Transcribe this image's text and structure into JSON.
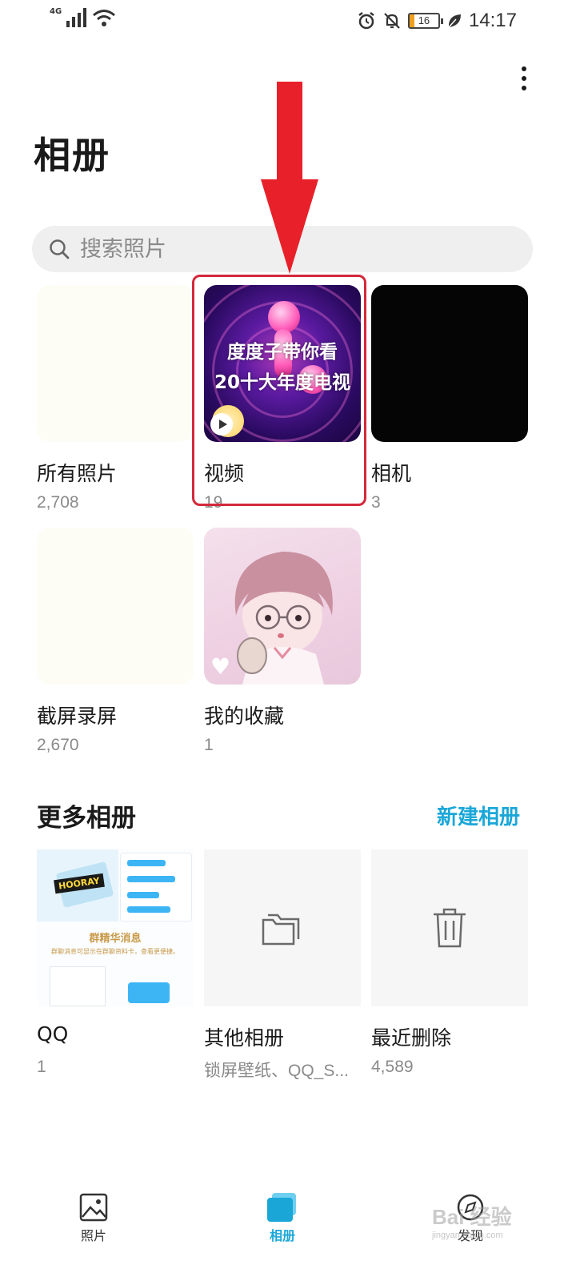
{
  "status_bar": {
    "network": "4G",
    "battery": "16",
    "time": "14:17"
  },
  "header": {
    "title": "相册",
    "more_icon": "more-vertical-icon"
  },
  "search": {
    "placeholder": "搜索照片",
    "icon": "search-icon"
  },
  "albums": [
    {
      "name": "所有照片",
      "count": "2,708"
    },
    {
      "name": "视频",
      "count": "19",
      "thumb_text_line1": "度度子带你看",
      "thumb_text_line2": "20十大年度电视"
    },
    {
      "name": "相机",
      "count": "3"
    },
    {
      "name": "截屏录屏",
      "count": "2,670"
    },
    {
      "name": "我的收藏",
      "count": "1"
    }
  ],
  "more_albums": {
    "title": "更多相册",
    "new_label": "新建相册",
    "items": [
      {
        "name": "QQ",
        "count": "1",
        "thumb_badge": "HOORAY",
        "thumb_caption": "群精华消息",
        "thumb_subcaption": "群聊消息可显示在群聊资料卡，查看更便捷。"
      },
      {
        "name": "其他相册",
        "count": "锁屏壁纸、QQ_S...",
        "icon": "folder-icon"
      },
      {
        "name": "最近删除",
        "count": "4,589",
        "icon": "trash-icon"
      }
    ]
  },
  "bottom_nav": [
    {
      "label": "照片",
      "icon": "photo-icon",
      "active": false
    },
    {
      "label": "相册",
      "icon": "albums-icon",
      "active": true
    },
    {
      "label": "发现",
      "icon": "discover-icon",
      "active": false
    }
  ],
  "watermark": {
    "text": "Bai 经验",
    "subtext": "jingyan.baidu.com"
  },
  "colors": {
    "accent": "#1aa7d8",
    "highlight_border": "#d4283a",
    "annotation_arrow": "#e8202a",
    "count_text": "#8a8a8a"
  }
}
